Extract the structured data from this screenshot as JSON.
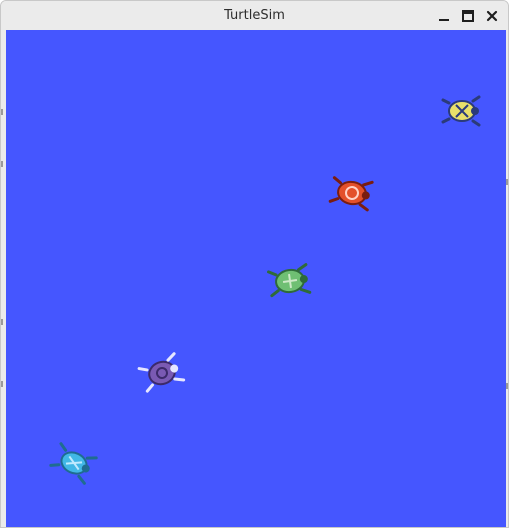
{
  "window": {
    "title": "TurtleSim",
    "controls": [
      "minimize-icon",
      "maximize-icon",
      "close-icon"
    ]
  },
  "canvas": {
    "background": "#4556ff"
  },
  "turtles": [
    {
      "name": "turtle-yellow",
      "color": "#e8e06a",
      "accent": "#2b3b7a"
    },
    {
      "name": "turtle-red",
      "color": "#e3502b",
      "accent": "#7a1d10"
    },
    {
      "name": "turtle-green",
      "color": "#6fbf73",
      "accent": "#2f6b39"
    },
    {
      "name": "turtle-purple",
      "color": "#7a5ab3",
      "accent": "#e6e6ff"
    },
    {
      "name": "turtle-cyan",
      "color": "#41b7e6",
      "accent": "#1f6c91"
    }
  ]
}
